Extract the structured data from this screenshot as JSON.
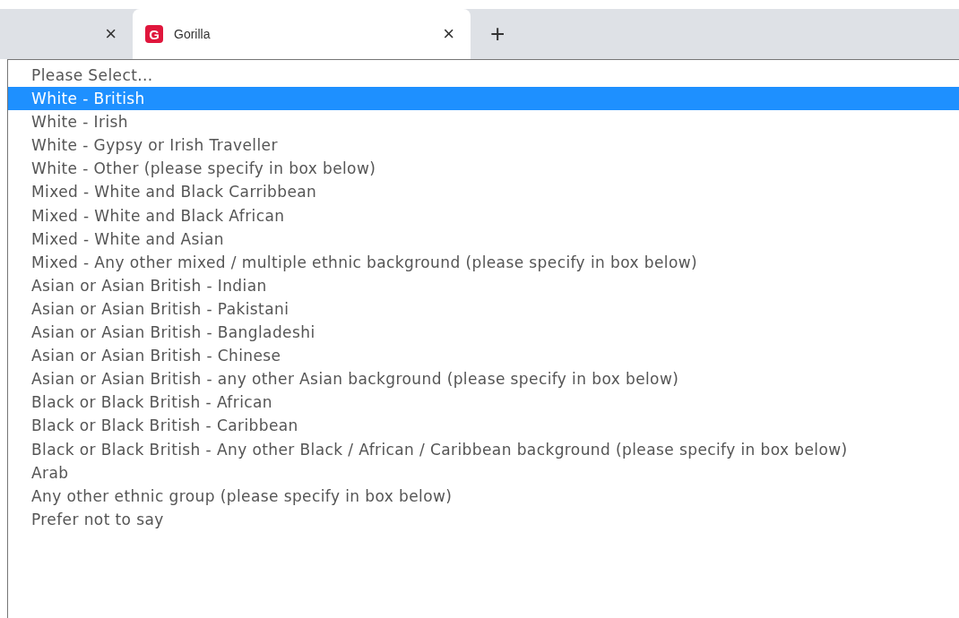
{
  "tabs": [
    {
      "selected": false,
      "close": "×"
    },
    {
      "title": "Gorilla",
      "selected": true,
      "close": "×",
      "favicon": "G"
    }
  ],
  "new_tab": "+",
  "dropdown": {
    "options": [
      {
        "label": "Please Select...",
        "selected": false
      },
      {
        "label": "White - British",
        "selected": true
      },
      {
        "label": "White - Irish",
        "selected": false
      },
      {
        "label": "White - Gypsy or Irish Traveller",
        "selected": false
      },
      {
        "label": "White - Other (please specify in box below)",
        "selected": false
      },
      {
        "label": "Mixed - White and Black Carribbean",
        "selected": false
      },
      {
        "label": "Mixed - White and Black African",
        "selected": false
      },
      {
        "label": "Mixed - White and Asian",
        "selected": false
      },
      {
        "label": "Mixed - Any other mixed / multiple ethnic background (please specify in box below)",
        "selected": false
      },
      {
        "label": "Asian or Asian British - Indian",
        "selected": false
      },
      {
        "label": "Asian or Asian British - Pakistani",
        "selected": false
      },
      {
        "label": "Asian or Asian British - Bangladeshi",
        "selected": false
      },
      {
        "label": "Asian or Asian British - Chinese",
        "selected": false
      },
      {
        "label": "Asian or Asian British - any other Asian background (please specify in box below)",
        "selected": false
      },
      {
        "label": "Black or Black British - African",
        "selected": false
      },
      {
        "label": "Black or Black British - Caribbean",
        "selected": false
      },
      {
        "label": "Black or Black British - Any other Black / African / Caribbean background (please specify in box below)",
        "selected": false
      },
      {
        "label": "Arab",
        "selected": false
      },
      {
        "label": "Any other ethnic group (please specify in box below)",
        "selected": false
      },
      {
        "label": "Prefer not to say",
        "selected": false
      }
    ]
  }
}
